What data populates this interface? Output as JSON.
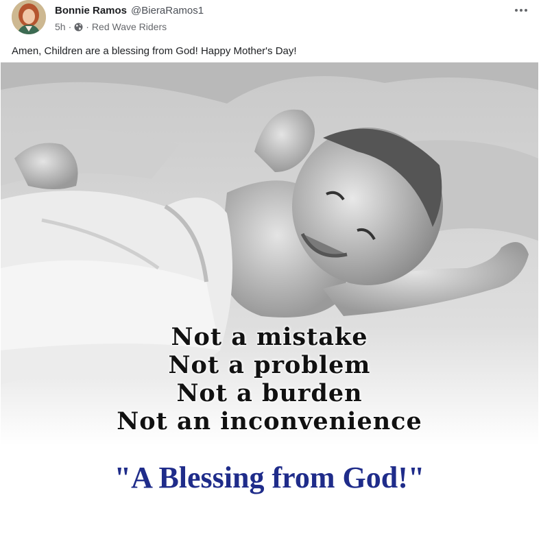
{
  "post": {
    "author_name": "Bonnie Ramos",
    "author_handle": "@BieraRamos1",
    "time": "5h",
    "group": "Red Wave Riders",
    "text": "Amen, Children are a blessing from God! Happy Mother's Day!"
  },
  "image": {
    "lines": [
      "Not a mistake",
      "Not a problem",
      "Not a burden",
      "Not an inconvenience"
    ],
    "blessing": "\"A Blessing from God!\"",
    "blessing_color": "#1f2c8a"
  },
  "icons": {
    "more": "more-options-icon",
    "audience": "globe-icon"
  }
}
